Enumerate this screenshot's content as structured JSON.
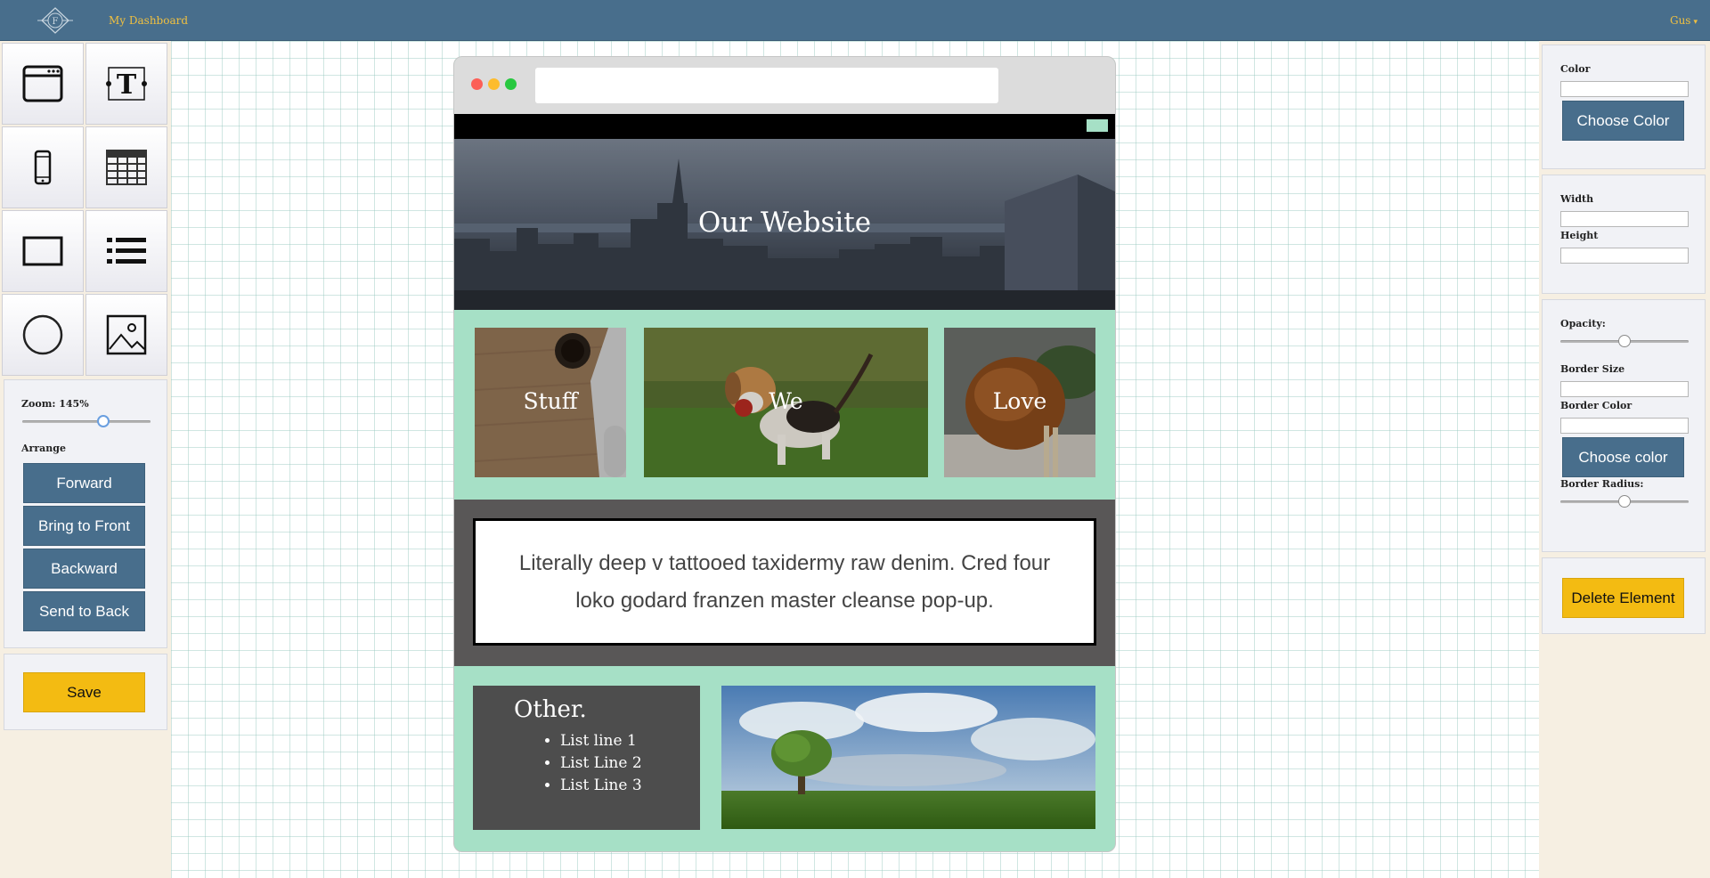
{
  "topbar": {
    "dashboard_link": "My Dashboard",
    "user_menu": "Gus"
  },
  "tools": [
    {
      "icon": "browser-window-icon"
    },
    {
      "icon": "text-tool-icon"
    },
    {
      "icon": "mobile-phone-icon"
    },
    {
      "icon": "table-icon"
    },
    {
      "icon": "rectangle-icon"
    },
    {
      "icon": "list-icon"
    },
    {
      "icon": "circle-icon"
    },
    {
      "icon": "image-icon"
    }
  ],
  "zoom": {
    "label": "Zoom: 145%",
    "level_fraction": 0.63
  },
  "arrange": {
    "label": "Arrange",
    "forward": "Forward",
    "bring_to_front": "Bring to Front",
    "backward": "Backward",
    "send_to_back": "Send to Back"
  },
  "save_label": "Save",
  "properties": {
    "color_label": "Color",
    "color_value": "",
    "choose_color": "Choose Color",
    "width_label": "Width",
    "width_value": "",
    "height_label": "Height",
    "height_value": "",
    "opacity_label": "Opacity:",
    "opacity_fraction": 0.5,
    "border_size_label": "Border Size",
    "border_size_value": "",
    "border_color_label": "Border Color",
    "border_color_value": "",
    "choose_border_color": "Choose color",
    "border_radius_label": "Border Radius:",
    "border_radius_fraction": 0.5,
    "delete_element": "Delete Element"
  },
  "mock_site": {
    "url": "",
    "hero_title": "Our Website",
    "tiles": [
      "Stuff",
      "We",
      "Love"
    ],
    "paragraph": "Literally deep v tattooed taxidermy raw denim. Cred four loko godard franzen master cleanse pop-up.",
    "other_title": "Other.",
    "list_items": [
      "List line 1",
      "List Line 2",
      "List Line 3"
    ]
  },
  "colors": {
    "nav_blue": "#486e8c",
    "accent_yellow": "#f3bb12",
    "mint": "#a6e0c6",
    "dark_band": "#595757"
  }
}
